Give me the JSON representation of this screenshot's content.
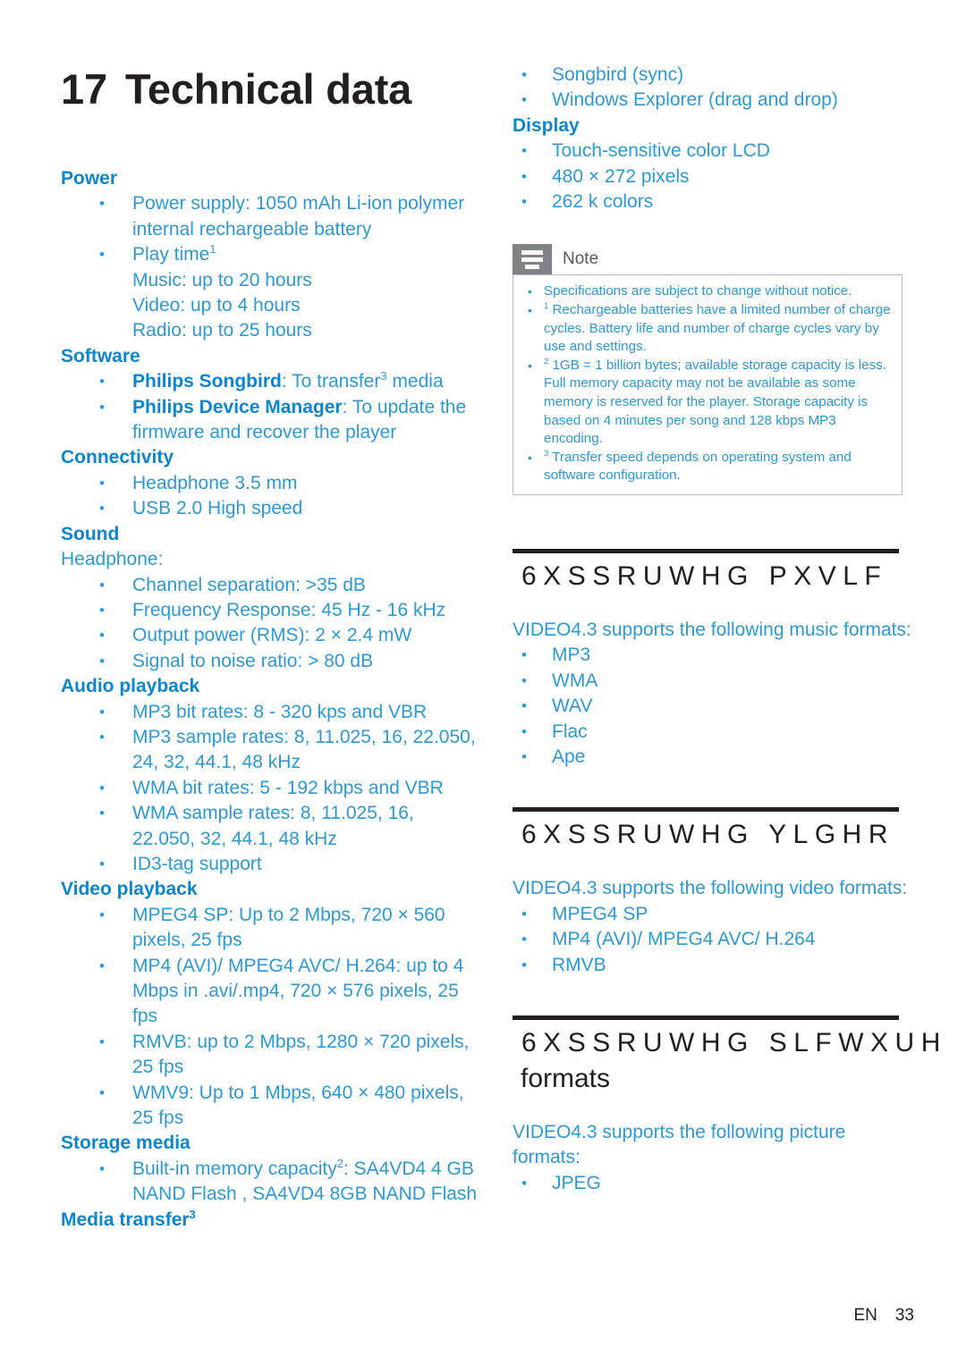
{
  "document": {
    "chapter_number": "17",
    "title": "Technical data",
    "footer_locale": "EN",
    "footer_page": "33"
  },
  "colors": {
    "body_blue": "#2b9ad8",
    "heading_blue": "#0d86d0",
    "black": "#231f20",
    "note_gray": "#808285"
  },
  "left_column": {
    "sections": [
      {
        "heading": "Power",
        "items": [
          "Power supply: 1050 mAh Li-ion polymer internal rechargeable battery",
          "Play time¹\nMusic: up to 20 hours\nVideo: up to 4 hours\nRadio: up to 25 hours"
        ]
      },
      {
        "heading": "Software",
        "items_rich": [
          {
            "bold": "Philips Songbird",
            "rest": ": To transfer³ media"
          },
          {
            "bold": "Philips Device Manager",
            "rest": ": To update the firmware and recover the player"
          }
        ]
      },
      {
        "heading": "Connectivity",
        "items": [
          "Headphone 3.5 mm",
          "USB 2.0 High speed"
        ]
      },
      {
        "heading": "Sound",
        "subheading": "Headphone:",
        "items": [
          "Channel separation: >35 dB",
          "Frequency Response: 45 Hz - 16 kHz",
          "Output power (RMS): 2 × 2.4 mW",
          "Signal to noise ratio: > 80 dB"
        ]
      },
      {
        "heading": "Audio playback",
        "items": [
          "MP3 bit rates: 8 - 320 kps and VBR",
          "MP3 sample rates: 8, 11.025, 16, 22.050, 24, 32, 44.1, 48 kHz",
          "WMA bit rates: 5 - 192 kbps and VBR",
          "WMA sample rates: 8, 11.025, 16, 22.050, 32, 44.1, 48 kHz",
          "ID3-tag support"
        ]
      },
      {
        "heading": "Video playback",
        "items": [
          "MPEG4 SP: Up to 2 Mbps, 720 × 560 pixels, 25 fps",
          "MP4 (AVI)/ MPEG4 AVC/ H.264: up to 4 Mbps in .avi/.mp4, 720 × 576 pixels, 25 fps",
          "RMVB: up to 2 Mbps, 1280 × 720 pixels, 25 fps",
          "WMV9: Up to 1 Mbps, 640 × 480 pixels, 25 fps"
        ]
      },
      {
        "heading": "Storage media",
        "items": [
          "Built-in memory capacity²: SA4VD4 4 GB NAND Flash , SA4VD4 8GB NAND Flash"
        ]
      },
      {
        "heading": "Media transfer³",
        "items": []
      }
    ]
  },
  "right_column": {
    "media_transfer_items": [
      "Songbird (sync)",
      "Windows Explorer (drag and drop)"
    ],
    "display": {
      "heading": "Display",
      "items": [
        "Touch-sensitive color LCD",
        "480 × 272 pixels",
        "262 k colors"
      ]
    },
    "note": {
      "icon_name": "note-lines-icon",
      "label": "Note",
      "items": [
        "Specifications are subject to change without notice.",
        "¹ Rechargeable batteries have a limited number of charge cycles. Battery life and number of charge cycles vary by use and settings.",
        "² 1GB = 1 billion bytes; available storage capacity is less. Full memory capacity may not be available as some memory is reserved for the player. Storage capacity is based on 4 minutes per song and 128 kbps MP3 encoding.",
        "³ Transfer speed depends on operating system and software configuration."
      ]
    },
    "blocks": [
      {
        "heading": "6XSSRUWHG PXVLF",
        "heading_line2": "",
        "intro": "VIDEO4.3 supports the following music formats:",
        "items": [
          "MP3",
          "WMA",
          "WAV",
          "Flac",
          "Ape"
        ]
      },
      {
        "heading": "6XSSRUWHG YLGHR",
        "heading_line2": "",
        "intro": "VIDEO4.3 supports the following video formats:",
        "items": [
          "MPEG4 SP",
          "MP4 (AVI)/ MPEG4 AVC/ H.264",
          "RMVB"
        ]
      },
      {
        "heading": "6XSSRUWHG SLFWXUH",
        "heading_line2": "formats",
        "intro": "VIDEO4.3 supports the following picture formats:",
        "items": [
          "JPEG"
        ]
      }
    ]
  }
}
